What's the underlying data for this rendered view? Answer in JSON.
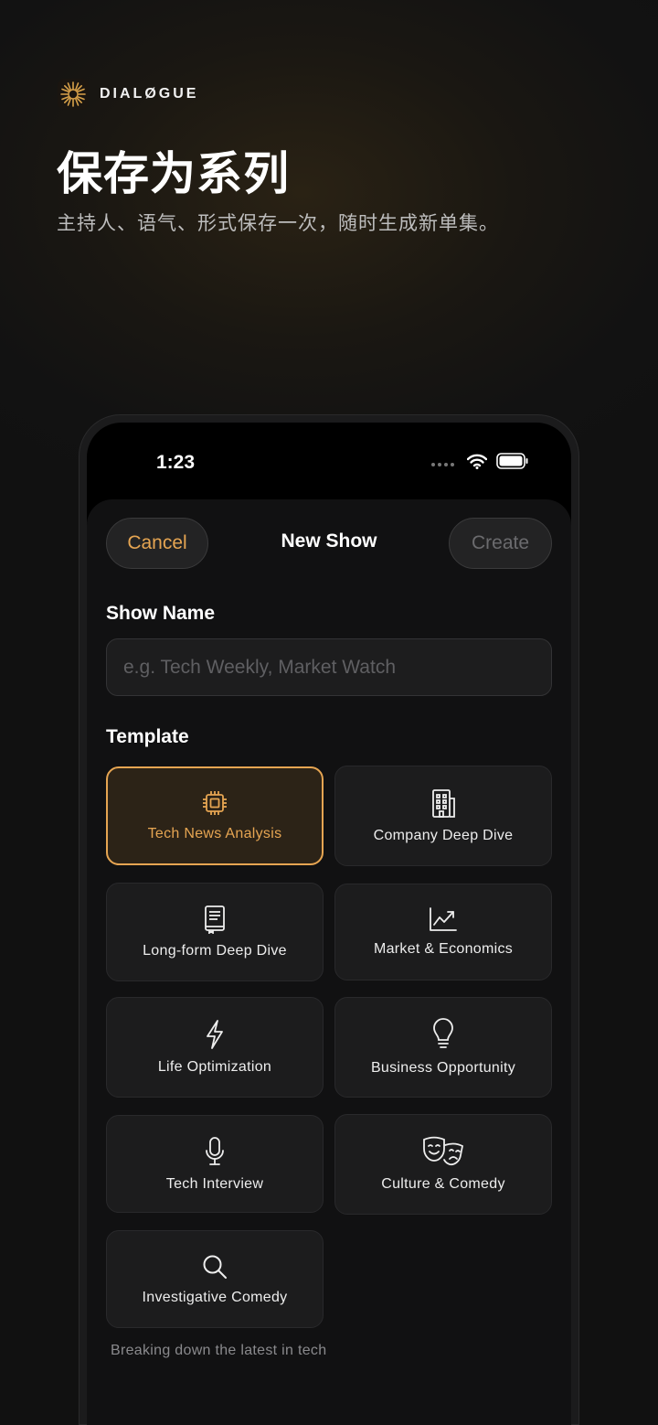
{
  "brand": {
    "name": "DIALØGUE"
  },
  "hero": {
    "title": "保存为系列",
    "subtitle": "主持人、语气、形式保存一次，随时生成新单集。"
  },
  "status_bar": {
    "time": "1:23"
  },
  "nav": {
    "cancel_label": "Cancel",
    "title": "New Show",
    "create_label": "Create"
  },
  "form": {
    "show_name_label": "Show Name",
    "show_name_placeholder": "e.g. Tech Weekly, Market Watch",
    "show_name_value": "",
    "template_label": "Template"
  },
  "templates": [
    {
      "label": "Tech News Analysis",
      "icon": "chip-icon",
      "selected": true
    },
    {
      "label": "Company Deep Dive",
      "icon": "building-icon",
      "selected": false
    },
    {
      "label": "Long-form Deep Dive",
      "icon": "book-icon",
      "selected": false
    },
    {
      "label": "Market & Economics",
      "icon": "chart-line-icon",
      "selected": false
    },
    {
      "label": "Life Optimization",
      "icon": "lightning-icon",
      "selected": false
    },
    {
      "label": "Business Opportunity",
      "icon": "lightbulb-icon",
      "selected": false
    },
    {
      "label": "Tech Interview",
      "icon": "microphone-icon",
      "selected": false
    },
    {
      "label": "Culture & Comedy",
      "icon": "theater-masks-icon",
      "selected": false
    },
    {
      "label": "Investigative Comedy",
      "icon": "search-icon",
      "selected": false
    }
  ],
  "template_description": "Breaking down the latest in tech",
  "colors": {
    "accent": "#e6a552",
    "background": "#111112",
    "card": "#1c1c1d"
  }
}
